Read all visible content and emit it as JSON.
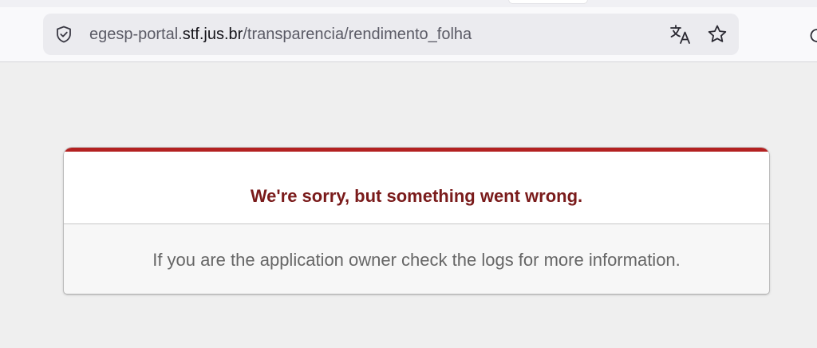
{
  "browser": {
    "url": {
      "prefix": "egesp-portal.",
      "domain": "stf.jus.br",
      "path": "/transparencia/rendimento_folha"
    },
    "icons": {
      "site_security": "shield-icon",
      "translate": "translate-icon",
      "bookmark": "star-icon",
      "reload": "reload-icon"
    }
  },
  "error_page": {
    "title": "We're sorry, but something went wrong.",
    "message": "If you are the application owner check the logs for more information.",
    "colors": {
      "accent_border": "#b32121",
      "title": "#7a1b1b",
      "message": "#666666"
    }
  }
}
